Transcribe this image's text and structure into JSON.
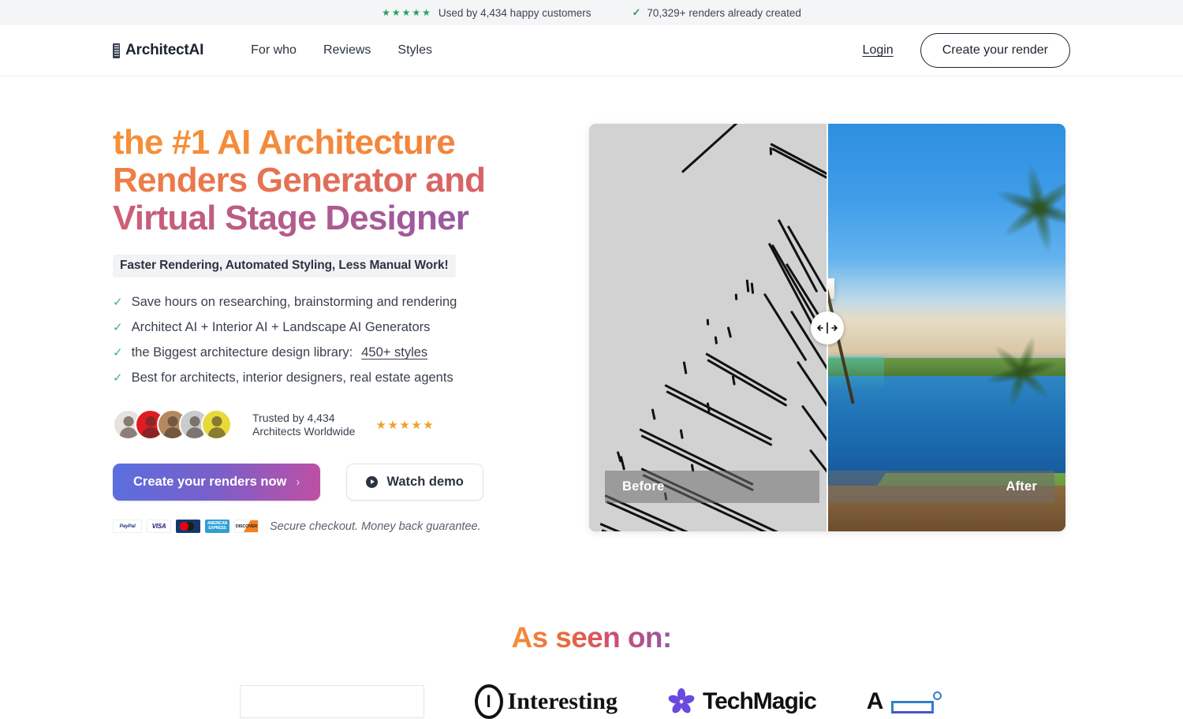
{
  "topbar": {
    "stars": "★★★★★",
    "customers_text": "Used by 4,434 happy customers",
    "check": "✓",
    "renders_text": "70,329+ renders already created"
  },
  "nav": {
    "brand": "ArchitectAI",
    "links": [
      {
        "label": "For who"
      },
      {
        "label": "Reviews"
      },
      {
        "label": "Styles"
      }
    ],
    "login_label": "Login",
    "cta_label": "Create your render"
  },
  "hero": {
    "headline_line1": "the #1 AI Architecture",
    "headline_line2": "Renders Generator and",
    "headline_line3": "Virtual Stage Designer",
    "subhead": "Faster Rendering, Automated Styling, Less Manual Work!",
    "bullets": [
      {
        "tick": "✓",
        "text": "Save hours on researching, brainstorming and rendering",
        "link": ""
      },
      {
        "tick": "✓",
        "text": "Architect AI + Interior AI + Landscape AI Generators",
        "link": ""
      },
      {
        "tick": "✓",
        "text": "the Biggest architecture design library: ",
        "link": "450+ styles"
      },
      {
        "tick": "✓",
        "text": "Best for architects, interior designers, real estate agents",
        "link": ""
      }
    ],
    "trust": {
      "line1": "Trusted by 4,434",
      "line2": "Architects Worldwide",
      "stars": "★★★★★",
      "avatar_colors": [
        "#e8e2dc",
        "#e01b24",
        "#b5895f",
        "#c9cbcd",
        "#e8d93a"
      ]
    },
    "primary_cta": "Create your renders now",
    "primary_cta_chevron": "›",
    "secondary_cta": "Watch demo",
    "payments": [
      {
        "name": "PayPal",
        "label": "PayPal"
      },
      {
        "name": "VISA",
        "label": "VISA"
      },
      {
        "name": "Mastercard",
        "label": ""
      },
      {
        "name": "American Express",
        "label": "AMERICAN EXPRESS"
      },
      {
        "name": "Discover",
        "label": "DISCOVER"
      }
    ],
    "payment_note": "Secure checkout. Money back guarantee."
  },
  "compare": {
    "before_label": "Before",
    "after_label": "After",
    "handle_icon": "↔"
  },
  "seen": {
    "title": "As seen on:",
    "logos": [
      {
        "name": "logo-placeholder",
        "label": ""
      },
      {
        "name": "interesting-engineering",
        "label": "Interesting"
      },
      {
        "name": "techmagic",
        "label": "TechMagic"
      },
      {
        "name": "archdaily",
        "label": "A"
      }
    ]
  },
  "colors": {
    "accent_orange": "#f4913a",
    "accent_purple": "#9257a8",
    "green": "#22a35a",
    "cta_gradient_start": "#5a6ee0",
    "cta_gradient_end": "#c04fa3"
  }
}
